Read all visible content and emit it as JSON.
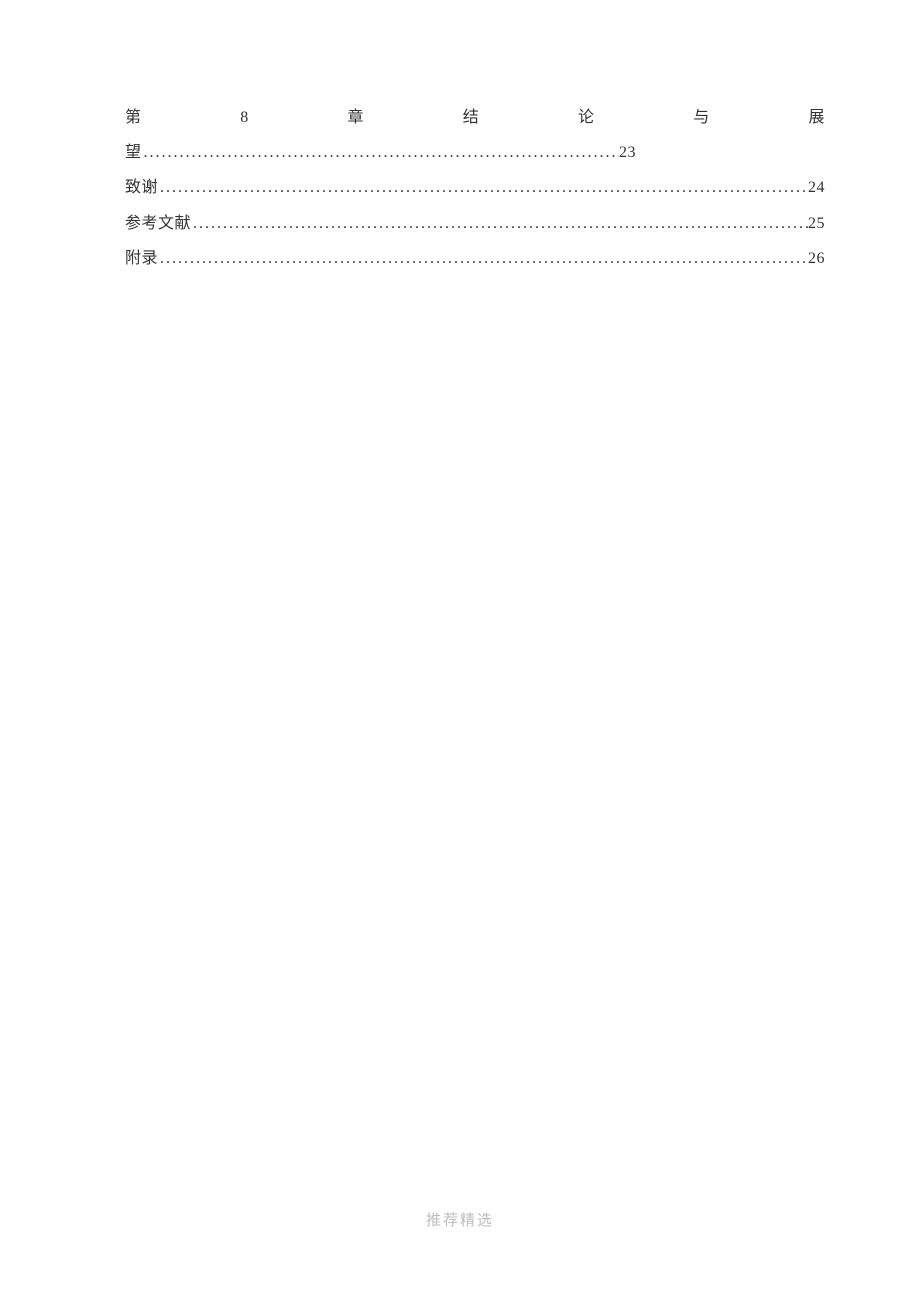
{
  "toc": {
    "entry_ch8": {
      "chars": {
        "c1": "第",
        "c2": "8",
        "c3": "章",
        "c4": "结",
        "c5": "论",
        "c6": "与",
        "c7": "展"
      },
      "wang": "望",
      "page": "23"
    },
    "entries": [
      {
        "title": "致谢",
        "page": "24"
      },
      {
        "title": "参考文献",
        "page": "25"
      },
      {
        "title": "附录",
        "page": "26"
      }
    ]
  },
  "footer": "推荐精选"
}
